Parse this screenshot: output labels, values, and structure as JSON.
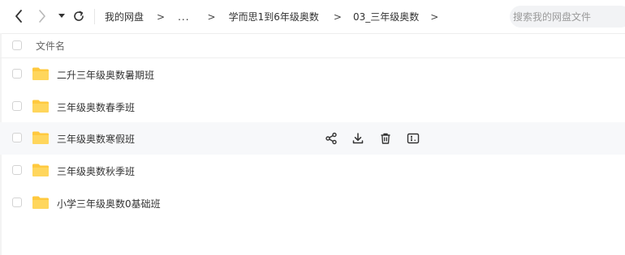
{
  "toolbar": {
    "back_icon": "chevron-left-icon",
    "forward_icon": "chevron-right-icon",
    "history_icon": "caret-down-icon",
    "refresh_icon": "refresh-icon"
  },
  "breadcrumb": {
    "root": "我的网盘",
    "separator": ">",
    "ellipsis": "...",
    "items": [
      "学而思1到6年级奥数",
      "03_三年级奥数"
    ],
    "trailing_separator": ">"
  },
  "search": {
    "placeholder": "搜索我的网盘文件"
  },
  "list": {
    "column_header": "文件名",
    "rows": [
      {
        "name": "二升三年级奥数暑期班",
        "icon": "folder-icon"
      },
      {
        "name": "三年级奥数春季班",
        "icon": "folder-icon"
      },
      {
        "name": "三年级奥数寒假班",
        "icon": "folder-icon",
        "hovered": true
      },
      {
        "name": "三年级奥数秋季班",
        "icon": "folder-icon"
      },
      {
        "name": "小学三年级奥数0基础班",
        "icon": "folder-icon"
      }
    ],
    "row_actions": [
      "share-icon",
      "download-icon",
      "delete-icon",
      "rename-icon"
    ]
  },
  "colors": {
    "folder": "#FFC93E",
    "hover_row": "#f7f8fa",
    "search_bg": "#f2f3f5"
  }
}
